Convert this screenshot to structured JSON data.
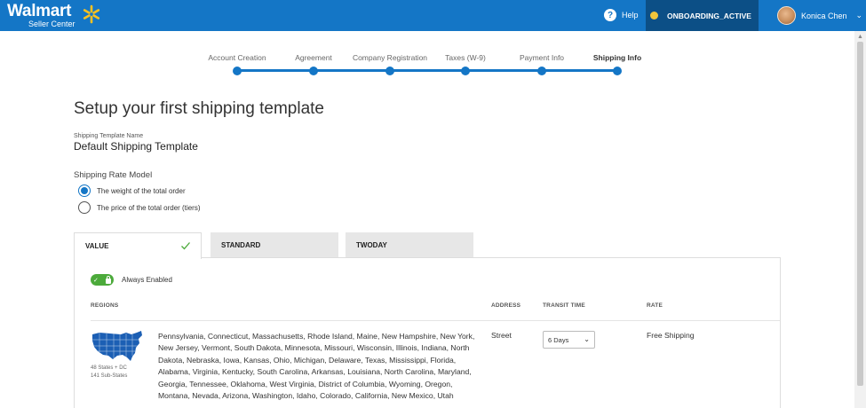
{
  "header": {
    "brand": "Walmart",
    "brand_sub": "Seller Center",
    "help_label": "Help",
    "status_label": "ONBOARDING_ACTIVE",
    "user_name": "Konica Chen",
    "colors": {
      "bar": "#1476c6",
      "status_bg": "#0c4f86",
      "status_dot": "#f0c53b",
      "spark": "#fcc220"
    }
  },
  "stepper": {
    "steps": [
      {
        "label": "Account Creation"
      },
      {
        "label": "Agreement"
      },
      {
        "label": "Company Registration"
      },
      {
        "label": "Taxes (W-9)"
      },
      {
        "label": "Payment Info"
      },
      {
        "label": "Shipping Info"
      }
    ]
  },
  "page": {
    "title": "Setup your first shipping template",
    "template_name_label": "Shipping Template Name",
    "template_name_value": "Default Shipping Template",
    "rate_model_label": "Shipping Rate Model",
    "rate_options": [
      {
        "label": "The weight of the total order",
        "selected": true
      },
      {
        "label": "The price of the total order (tiers)",
        "selected": false
      }
    ]
  },
  "tabs": [
    {
      "label": "VALUE",
      "active": true
    },
    {
      "label": "STANDARD",
      "active": false
    },
    {
      "label": "TWODAY",
      "active": false
    }
  ],
  "panel": {
    "always_enabled_label": "Always Enabled",
    "columns": {
      "regions": "REGIONS",
      "address": "ADDRESS",
      "transit": "TRANSIT TIME",
      "rate": "RATE"
    },
    "row": {
      "map_caption_1": "48 States + DC",
      "map_caption_2": "141 Sub-States",
      "regions": "Pennsylvania, Connecticut, Massachusetts, Rhode Island, Maine, New Hampshire, New York, New Jersey, Vermont, South Dakota, Minnesota, Missouri, Wisconsin, Illinois, Indiana, North Dakota, Nebraska, Iowa, Kansas, Ohio, Michigan, Delaware, Texas, Mississippi, Florida, Alabama, Virginia, Kentucky, South Carolina, Arkansas, Louisiana, North Carolina, Maryland, Georgia, Tennessee, Oklahoma, West Virginia, District of Columbia, Wyoming, Oregon, Montana, Nevada, Arizona, Washington, Idaho, Colorado, California, New Mexico, Utah",
      "address": "Street",
      "transit": "6 Days",
      "rate": "Free Shipping"
    }
  }
}
